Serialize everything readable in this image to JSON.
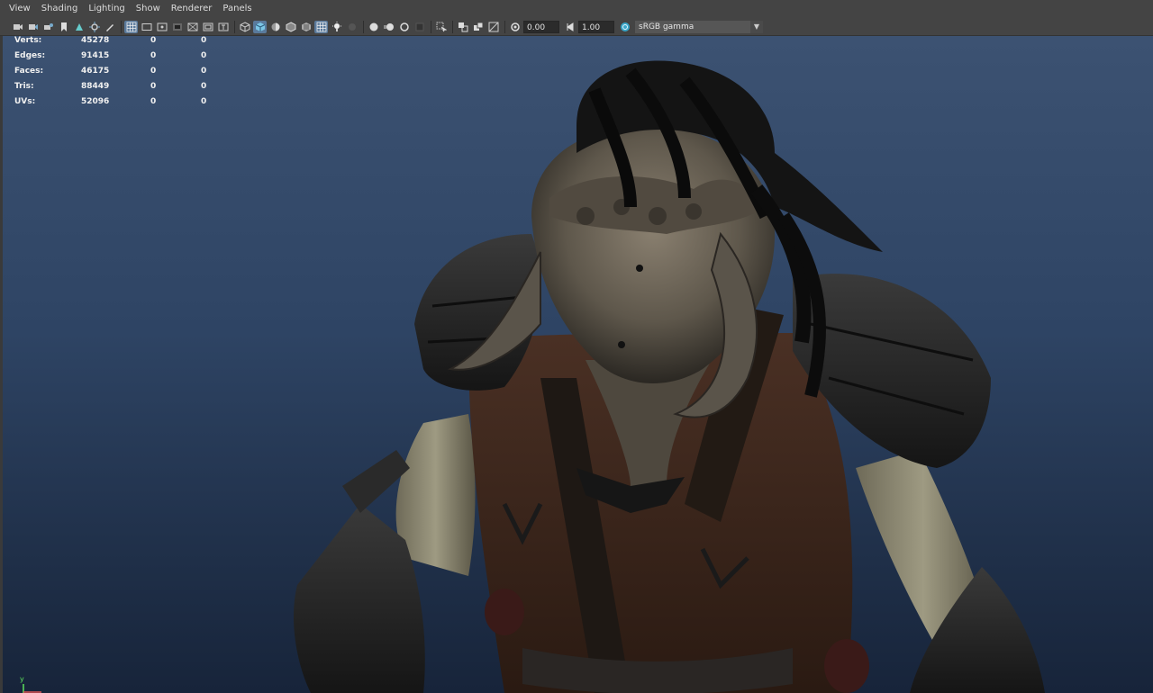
{
  "menu": [
    "View",
    "Shading",
    "Lighting",
    "Show",
    "Renderer",
    "Panels"
  ],
  "toolbar": {
    "exposure_value": "0.00",
    "gamma_value": "1.00",
    "color_space": "sRGB gamma"
  },
  "hud": {
    "rows": [
      {
        "label": "Verts:",
        "values": [
          "45278",
          "0",
          "0"
        ]
      },
      {
        "label": "Edges:",
        "values": [
          "91415",
          "0",
          "0"
        ]
      },
      {
        "label": "Faces:",
        "values": [
          "46175",
          "0",
          "0"
        ]
      },
      {
        "label": "Tris:",
        "values": [
          "88449",
          "0",
          "0"
        ]
      },
      {
        "label": "UVs:",
        "values": [
          "52096",
          "0",
          "0"
        ]
      }
    ]
  },
  "axis": {
    "y_label": "y"
  },
  "colors": {
    "ui_background": "#444444",
    "viewport_top": "#3c5272",
    "viewport_bottom": "#17243a",
    "active_button": "#5a7a9c"
  }
}
